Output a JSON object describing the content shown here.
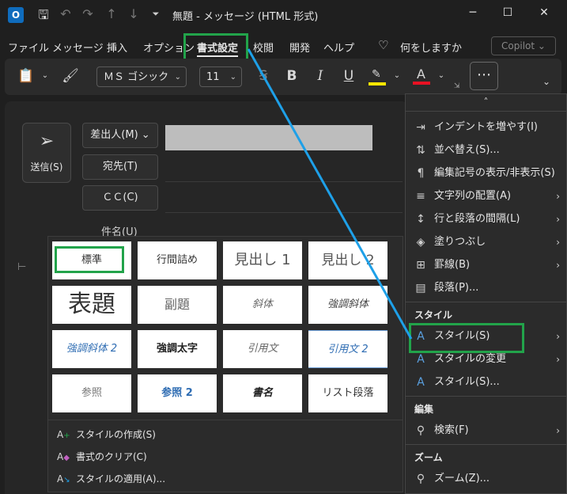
{
  "titlebar": {
    "title": "無題  -  メッセージ (HTML 形式)",
    "app_icon": "outlook-icon",
    "minimize": "─",
    "maximize": "☐",
    "close": "✕"
  },
  "menu_tabs": [
    "ファイル",
    "メッセージ",
    "挿入",
    "オプション",
    "書式設定",
    "校閲",
    "開発",
    "ヘルプ"
  ],
  "menu_active": "書式設定",
  "search_hint": "何をしますか",
  "copilot": "Copilot",
  "ribbon": {
    "font_name": "ＭＳ ゴシック",
    "font_size": "11",
    "bold": "B",
    "italic": "I",
    "underline": "U",
    "highlight_color": "#ffe600",
    "font_color": "#e81123",
    "more": "⋯"
  },
  "compose": {
    "send_label": "送信(S)",
    "from_label": "差出人(M)",
    "to_label": "宛先(T)",
    "cc_label": "ＣＣ(C)",
    "subject_label": "件名(U)"
  },
  "gallery": {
    "tiles": [
      "標準",
      "行間詰め",
      "見出し 1",
      "見出し 2",
      "表題",
      "副題",
      "斜体",
      "強調斜体",
      "強調斜体 2",
      "強調太字",
      "引用文",
      "引用文 2",
      "参照",
      "参照 2",
      "書名",
      "リスト段落"
    ],
    "actions": [
      "スタイルの作成(S)",
      "書式のクリア(C)",
      "スタイルの適用(A)..."
    ]
  },
  "overflow_menu": {
    "scroll_up": "˄",
    "items": [
      {
        "label": "インデントを増やす(I)",
        "icon": "indent-icon",
        "arrow": false
      },
      {
        "label": "並べ替え(S)...",
        "icon": "sort-icon",
        "arrow": false
      },
      {
        "label": "編集記号の表示/非表示(S)",
        "icon": "pilcrow-icon",
        "arrow": false
      },
      {
        "label": "文字列の配置(A)",
        "icon": "align-icon",
        "arrow": true
      },
      {
        "label": "行と段落の間隔(L)",
        "icon": "line-spacing-icon",
        "arrow": true
      },
      {
        "label": "塗りつぶし",
        "icon": "paint-bucket-icon",
        "arrow": true
      },
      {
        "label": "罫線(B)",
        "icon": "borders-icon",
        "arrow": true
      },
      {
        "label": "段落(P)...",
        "icon": "paragraph-icon",
        "arrow": false
      }
    ],
    "section_styles": "スタイル",
    "style_items": [
      {
        "label": "スタイル(S)",
        "icon": "styles-icon",
        "arrow": true
      },
      {
        "label": "スタイルの変更",
        "icon": "change-styles-icon",
        "arrow": true
      },
      {
        "label": "スタイル(S)...",
        "icon": "styles-pane-icon",
        "arrow": false
      }
    ],
    "section_edit": "編集",
    "edit_items": [
      {
        "label": "検索(F)",
        "icon": "search-icon",
        "arrow": true
      }
    ],
    "section_zoom": "ズーム",
    "zoom_items": [
      {
        "label": "ズーム(Z)...",
        "icon": "zoom-icon",
        "arrow": false
      }
    ]
  },
  "colors": {
    "highlight_box": "#22a34a",
    "connector_line": "#1ea0e8"
  }
}
